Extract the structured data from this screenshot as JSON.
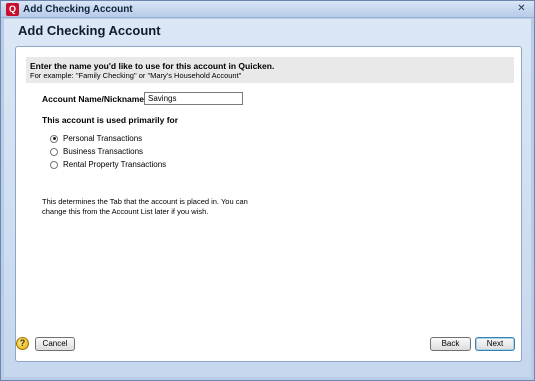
{
  "window": {
    "title": "Add Checking Account",
    "close_glyph": "✕"
  },
  "page": {
    "heading": "Add Checking Account"
  },
  "instructions": {
    "main": "Enter the name you'd like to use for this account in Quicken.",
    "example": "For example: \"Family Checking\" or \"Mary's Household Account\""
  },
  "form": {
    "name_label": "Account Name/Nickname",
    "name_value": "Savings",
    "usage_label": "This account is used primarily for",
    "options": [
      {
        "label": "Personal Transactions",
        "checked": true
      },
      {
        "label": "Business Transactions",
        "checked": false
      },
      {
        "label": "Rental Property Transactions",
        "checked": false
      }
    ],
    "note": "This determines the Tab that the account is placed in. You can change this from the Account List later if you wish."
  },
  "footer": {
    "help_glyph": "?",
    "cancel_label": "Cancel",
    "back_label": "Back",
    "next_label": "Next"
  }
}
